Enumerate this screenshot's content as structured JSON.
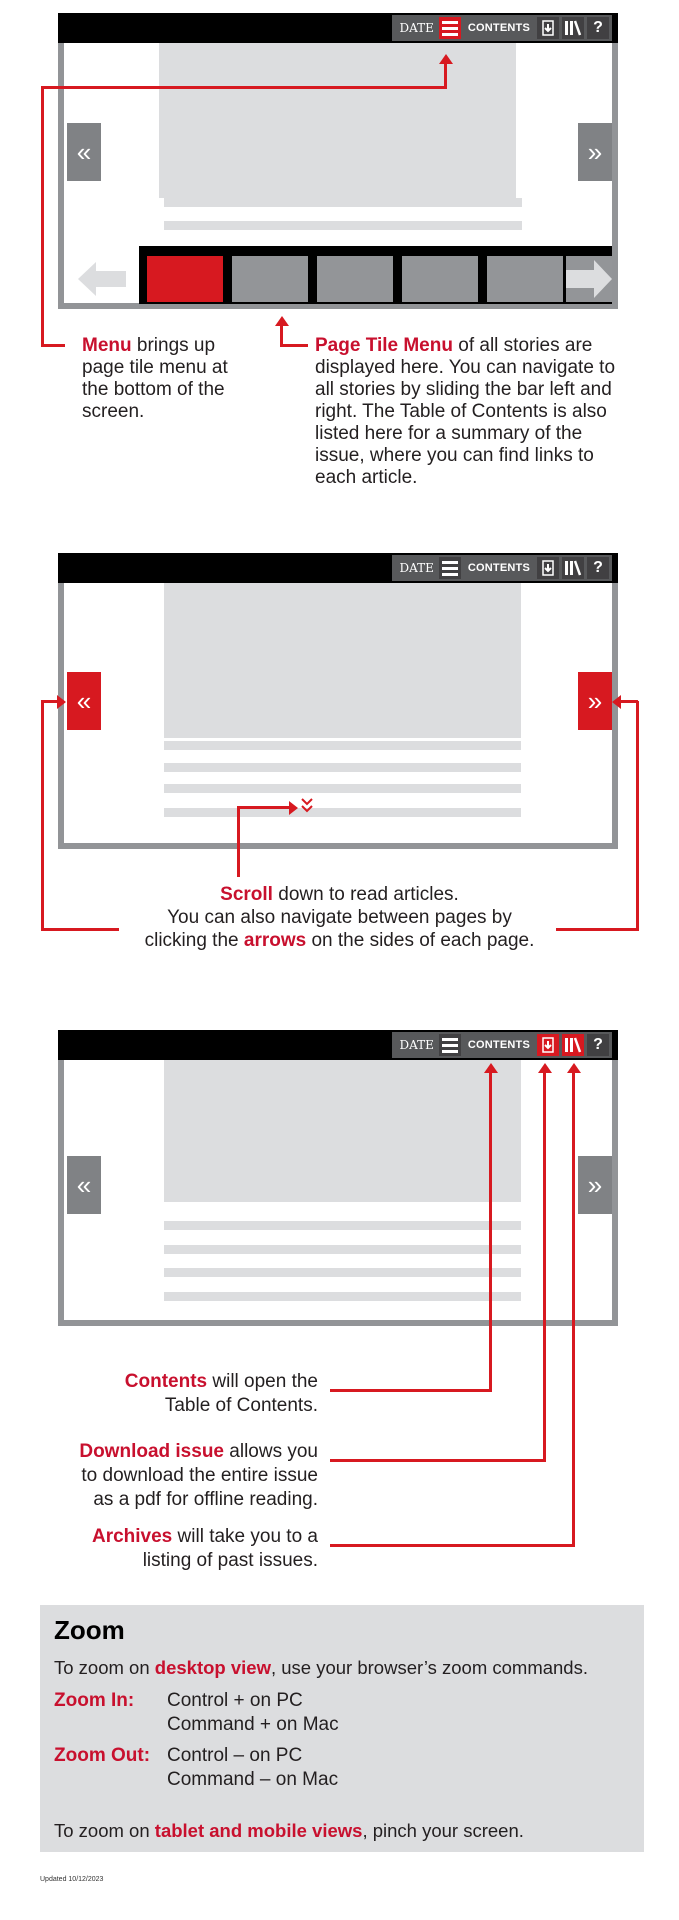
{
  "toolbar": {
    "date_label": "DATE",
    "contents_label": "CONTENTS",
    "help_label": "?",
    "icons": {
      "menu": "hamburger-menu-icon",
      "download": "download-issue-icon",
      "archives": "archives-books-icon",
      "help": "help-icon"
    }
  },
  "nav": {
    "prev_glyph": "«",
    "next_glyph": "»",
    "scroll_glyph": "»"
  },
  "section1": {
    "menu_callout": {
      "highlight": "Menu",
      "text": " brings up page tile menu at the bottom of the screen."
    },
    "tile_callout": {
      "highlight": "Page Tile Menu",
      "text": " of all stories are displayed here. You can navigate to all stories by sliding the bar left and right. The Table of Contents is also listed here for a summary of the issue, where you can find links to each article."
    },
    "tiles": [
      "active",
      "inactive",
      "inactive",
      "inactive",
      "inactive"
    ]
  },
  "section2": {
    "line1_highlight": "Scroll",
    "line1_text": " down to read articles.",
    "line2_text": "You can also navigate between pages by",
    "line3_pre": "clicking the ",
    "line3_highlight": "arrows",
    "line3_post": " on the sides of each page."
  },
  "section3": {
    "contents": {
      "highlight": "Contents",
      "text": " will open the",
      "text2": "Table of Contents."
    },
    "download": {
      "highlight": "Download issue",
      "text": " allows you",
      "text2": "to download the entire issue",
      "text3": "as a pdf for offline reading."
    },
    "archives": {
      "highlight": "Archives",
      "text": " will take you to a",
      "text2": "listing of past issues."
    }
  },
  "zoom_box": {
    "title": "Zoom",
    "desktop_pre": "To zoom on ",
    "desktop_highlight": "desktop view",
    "desktop_post": ", use your browser’s zoom commands.",
    "zoom_in_label": "Zoom In:",
    "zoom_in_pc": "Control + on PC",
    "zoom_in_mac": "Command + on Mac",
    "zoom_out_label": "Zoom Out:",
    "zoom_out_pc": "Control – on PC",
    "zoom_out_mac": "Command – on Mac",
    "mobile_pre": "To zoom on ",
    "mobile_highlight": "tablet and mobile views",
    "mobile_post": ", pinch your screen."
  },
  "footer": {
    "updated": "Updated 10/12/2023"
  },
  "colors": {
    "accent": "#d71920",
    "frame": "#929497",
    "placeholder": "#dcdddf",
    "button_gray": "#808285"
  }
}
